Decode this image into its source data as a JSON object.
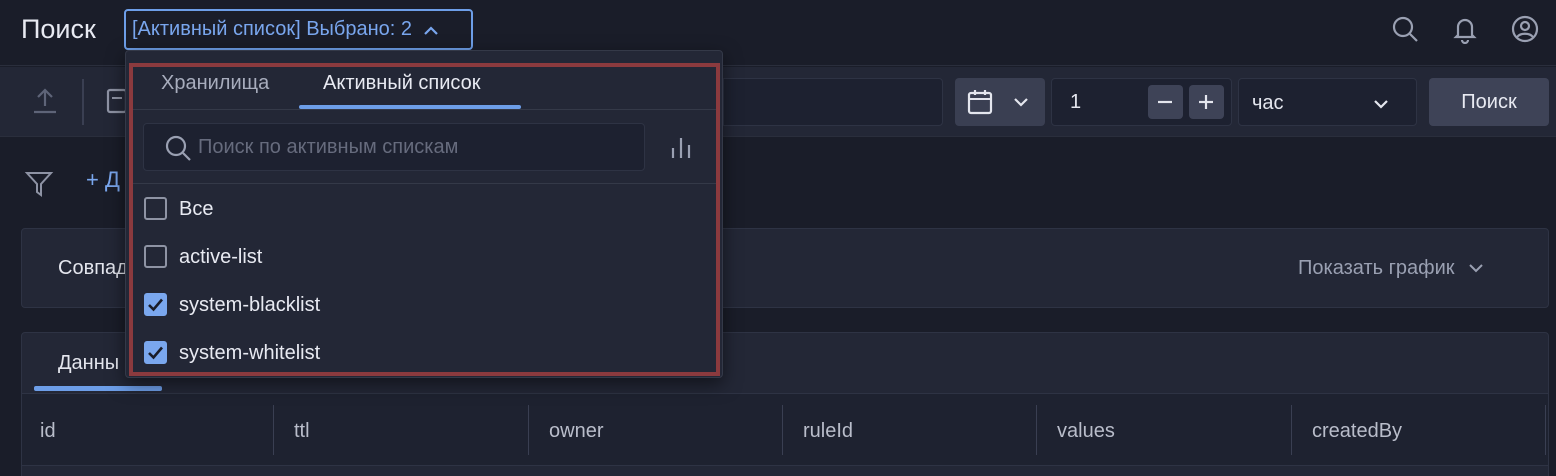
{
  "header": {
    "title": "Поиск",
    "selector_label": "[Активный список] Выбрано: 2"
  },
  "toolbar": {
    "quantity": "1",
    "unit": "час",
    "search_label": "Поиск"
  },
  "filters": {
    "add_label": "+ Д"
  },
  "matches_card": {
    "label": "Совпад",
    "show_chart_label": "Показать график"
  },
  "data_panel": {
    "tab_label": "Данны",
    "columns": [
      "id",
      "ttl",
      "owner",
      "ruleId",
      "values",
      "createdBy"
    ]
  },
  "dropdown": {
    "tabs": [
      {
        "label": "Хранилища",
        "active": false
      },
      {
        "label": "Активный список",
        "active": true
      }
    ],
    "search_placeholder": "Поиск по активным спискам",
    "items": [
      {
        "label": "Все",
        "checked": false
      },
      {
        "label": "active-list",
        "checked": false
      },
      {
        "label": "system-blacklist",
        "checked": true
      },
      {
        "label": "system-whitelist",
        "checked": true
      }
    ]
  },
  "colors": {
    "accent": "#6d9ee8",
    "highlight_border": "#8b3a3e",
    "background": "#1a1d29"
  }
}
